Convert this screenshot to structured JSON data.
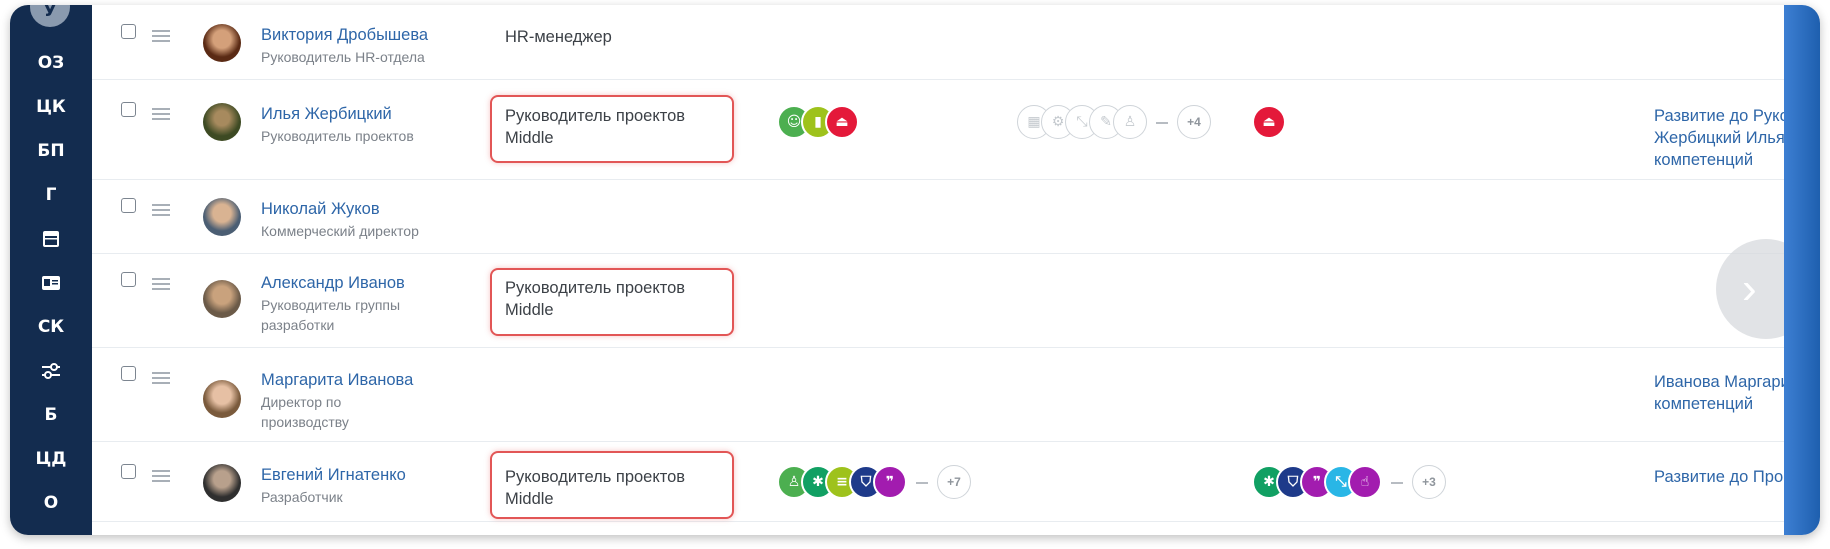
{
  "sidebar": {
    "avatar_letter": "У",
    "items": [
      {
        "label": "ОЗ",
        "icon": ""
      },
      {
        "label": "ЦК",
        "icon": ""
      },
      {
        "label": "БП",
        "icon": ""
      },
      {
        "label": "Г",
        "icon": ""
      },
      {
        "label": "",
        "icon": "calendar-icon"
      },
      {
        "label": "",
        "icon": "contact-card-icon"
      },
      {
        "label": "СК",
        "icon": ""
      },
      {
        "label": "",
        "icon": "sliders-icon"
      },
      {
        "label": "Б",
        "icon": ""
      },
      {
        "label": "ЦД",
        "icon": ""
      },
      {
        "label": "О",
        "icon": ""
      }
    ]
  },
  "employees": [
    {
      "name": "Виктория Дробышева",
      "role": "Руководитель HR-отдела",
      "position": "HR-менеджер",
      "development": ""
    },
    {
      "name": "Илья Жербицкий",
      "role": "Руководитель проектов",
      "position": "Руководитель проектов Middle",
      "badges_more": "+4",
      "development": "Развитие до Руков Жербицкий Илья компетенций"
    },
    {
      "name": "Николай Жуков",
      "role": "Коммерческий директор",
      "position": "",
      "development": ""
    },
    {
      "name": "Александр Иванов",
      "role": "Руководитель группы разработки",
      "position": "Руководитель проектов Middle",
      "development": ""
    },
    {
      "name": "Маргарита Иванова",
      "role": "Директор по производству",
      "position": "",
      "development": "Иванова Маргари компетенций"
    },
    {
      "name": "Евгений Игнатенко",
      "role": "Разработчик",
      "position": "Руководитель проектов Middle",
      "badges_more": "+7",
      "badges2_more": "+3",
      "development": "Развитие до Прогр"
    }
  ],
  "colors": {
    "sidebar_bg": "#132c4f",
    "link": "#2e66a8",
    "highlight": "#e25656",
    "badge_green": "#4caf50",
    "badge_lime": "#9ec21c",
    "badge_red": "#e4193a",
    "badge_teal": "#11a063",
    "badge_navy": "#1e3a8a",
    "badge_purple": "#a21caf",
    "badge_cyan": "#29b6e6"
  }
}
